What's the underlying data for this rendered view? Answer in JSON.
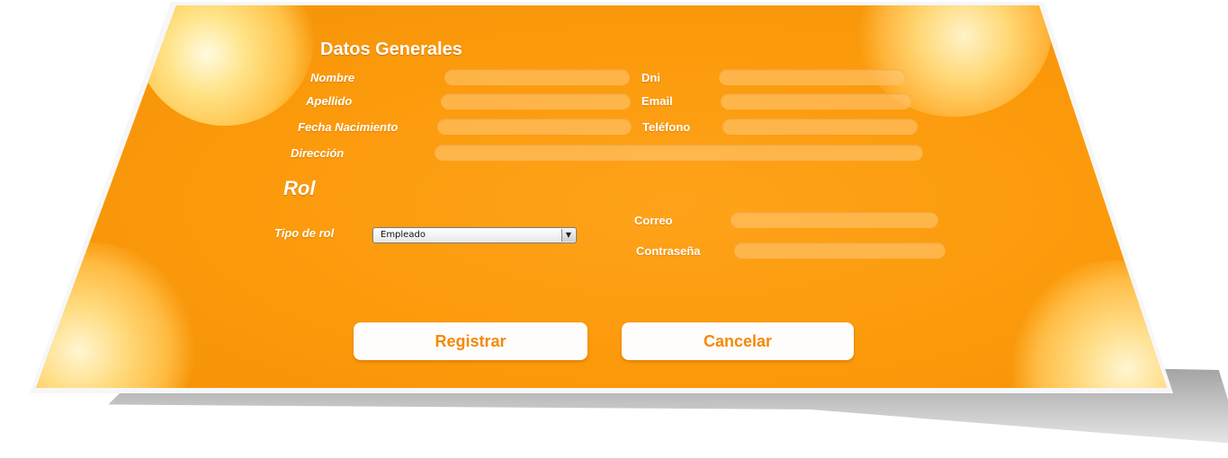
{
  "datos_generales": {
    "title": "Datos Generales",
    "fields": {
      "nombre": "Nombre",
      "dni": "Dni",
      "apellido": "Apellido",
      "email": "Email",
      "fecha_nacimiento": "Fecha Nacimiento",
      "telefono": "Teléfono",
      "direccion": "Dirección"
    }
  },
  "rol": {
    "title": "Rol",
    "tipo_label": "Tipo de rol",
    "tipo_value": "Empleado",
    "correo_label": "Correo",
    "contrasena_label": "Contraseña"
  },
  "actions": {
    "registrar": "Registrar",
    "cancelar": "Cancelar"
  },
  "colors": {
    "accent": "#f3890a",
    "background": "#fb9a0b"
  },
  "icons": {
    "dropdown": "chevron-down-icon"
  }
}
